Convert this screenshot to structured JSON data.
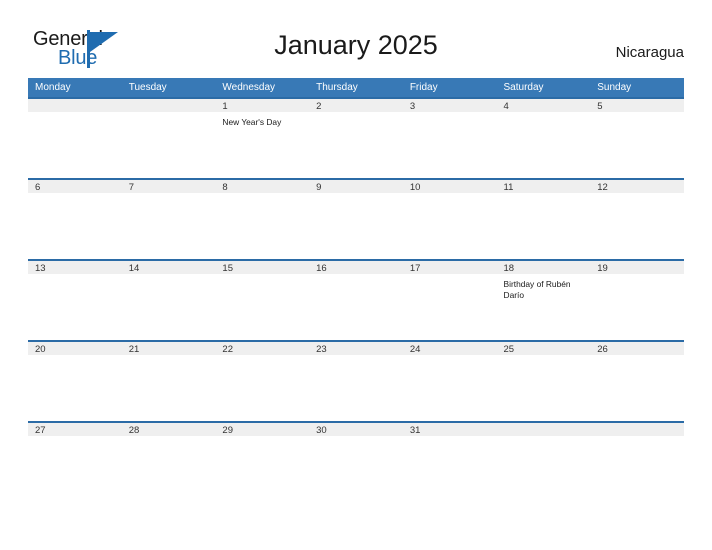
{
  "brand": {
    "name_part1": "General",
    "name_part2": "Blue",
    "mark": "triangle-flag"
  },
  "header": {
    "title": "January 2025",
    "country": "Nicaragua"
  },
  "colors": {
    "header_blue": "#3879b6",
    "row_rule_blue": "#2b6ba6",
    "band_gray": "#efefef",
    "brand_blue": "#1f6cb0"
  },
  "calendar": {
    "weekdays": [
      "Monday",
      "Tuesday",
      "Wednesday",
      "Thursday",
      "Friday",
      "Saturday",
      "Sunday"
    ],
    "weeks": [
      [
        {
          "day": "",
          "events": []
        },
        {
          "day": "",
          "events": []
        },
        {
          "day": "1",
          "events": [
            "New Year's Day"
          ]
        },
        {
          "day": "2",
          "events": []
        },
        {
          "day": "3",
          "events": []
        },
        {
          "day": "4",
          "events": []
        },
        {
          "day": "5",
          "events": []
        }
      ],
      [
        {
          "day": "6",
          "events": []
        },
        {
          "day": "7",
          "events": []
        },
        {
          "day": "8",
          "events": []
        },
        {
          "day": "9",
          "events": []
        },
        {
          "day": "10",
          "events": []
        },
        {
          "day": "11",
          "events": []
        },
        {
          "day": "12",
          "events": []
        }
      ],
      [
        {
          "day": "13",
          "events": []
        },
        {
          "day": "14",
          "events": []
        },
        {
          "day": "15",
          "events": []
        },
        {
          "day": "16",
          "events": []
        },
        {
          "day": "17",
          "events": []
        },
        {
          "day": "18",
          "events": [
            "Birthday of Rubén Darío"
          ]
        },
        {
          "day": "19",
          "events": []
        }
      ],
      [
        {
          "day": "20",
          "events": []
        },
        {
          "day": "21",
          "events": []
        },
        {
          "day": "22",
          "events": []
        },
        {
          "day": "23",
          "events": []
        },
        {
          "day": "24",
          "events": []
        },
        {
          "day": "25",
          "events": []
        },
        {
          "day": "26",
          "events": []
        }
      ],
      [
        {
          "day": "27",
          "events": []
        },
        {
          "day": "28",
          "events": []
        },
        {
          "day": "29",
          "events": []
        },
        {
          "day": "30",
          "events": []
        },
        {
          "day": "31",
          "events": []
        },
        {
          "day": "",
          "events": []
        },
        {
          "day": "",
          "events": []
        }
      ]
    ]
  }
}
